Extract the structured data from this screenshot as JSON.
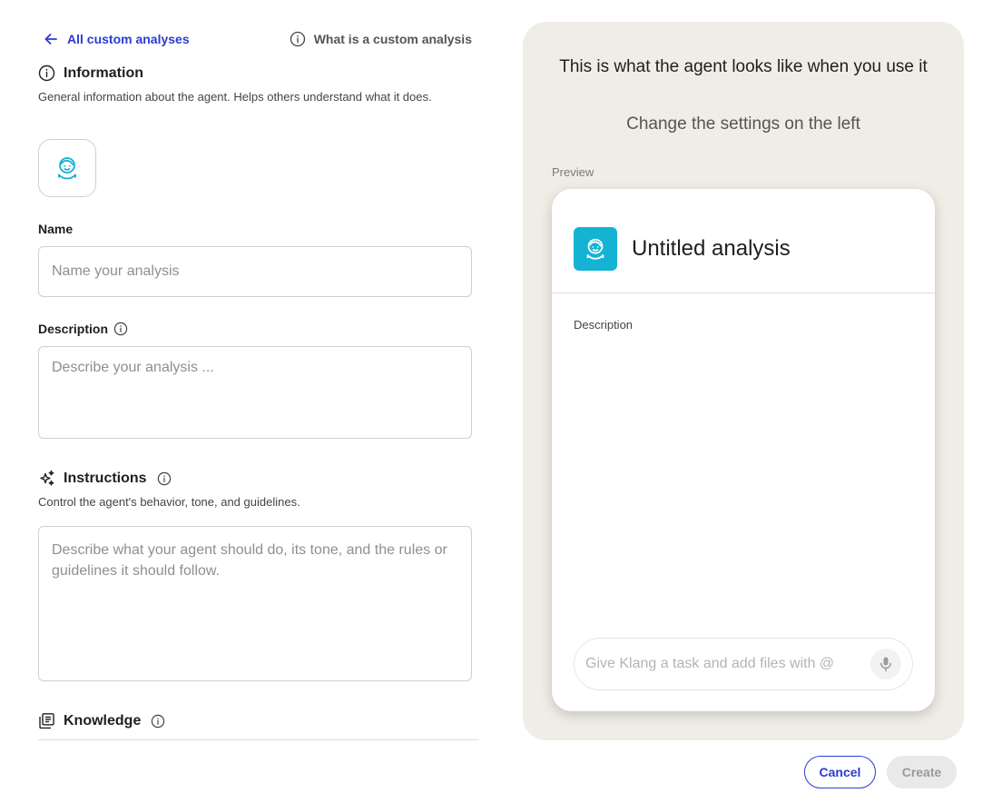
{
  "topbar": {
    "back_label": "All custom analyses",
    "help_label": "What is a custom analysis"
  },
  "information": {
    "heading": "Information",
    "description": "General information about the agent. Helps others understand what it does."
  },
  "name_field": {
    "label": "Name",
    "placeholder": "Name your analysis"
  },
  "description_field": {
    "label": "Description",
    "placeholder": "Describe your analysis ..."
  },
  "instructions": {
    "heading": "Instructions",
    "description": "Control the agent's behavior, tone, and guidelines.",
    "placeholder": "Describe what your agent should do, its tone, and the rules or guidelines it should follow."
  },
  "knowledge": {
    "heading": "Knowledge"
  },
  "preview_panel": {
    "title": "This is what the agent looks like when you use it",
    "subtitle": "Change the settings on the left",
    "preview_label": "Preview",
    "agent_name": "Untitled analysis",
    "description_label": "Description",
    "chat_placeholder": "Give Klang a task and add files with @"
  },
  "footer": {
    "cancel_label": "Cancel",
    "create_label": "Create"
  },
  "colors": {
    "accent": "#2b3bd1",
    "avatar_bg": "#14b3d3",
    "panel_bg": "#f0ede6"
  },
  "icons": {
    "back": "arrow-left-icon",
    "help": "info-circle-icon",
    "information": "info-circle-icon",
    "avatar": "smiling-face-icon",
    "instructions": "sparkles-icon",
    "knowledge": "library-books-icon",
    "mic": "microphone-icon"
  }
}
